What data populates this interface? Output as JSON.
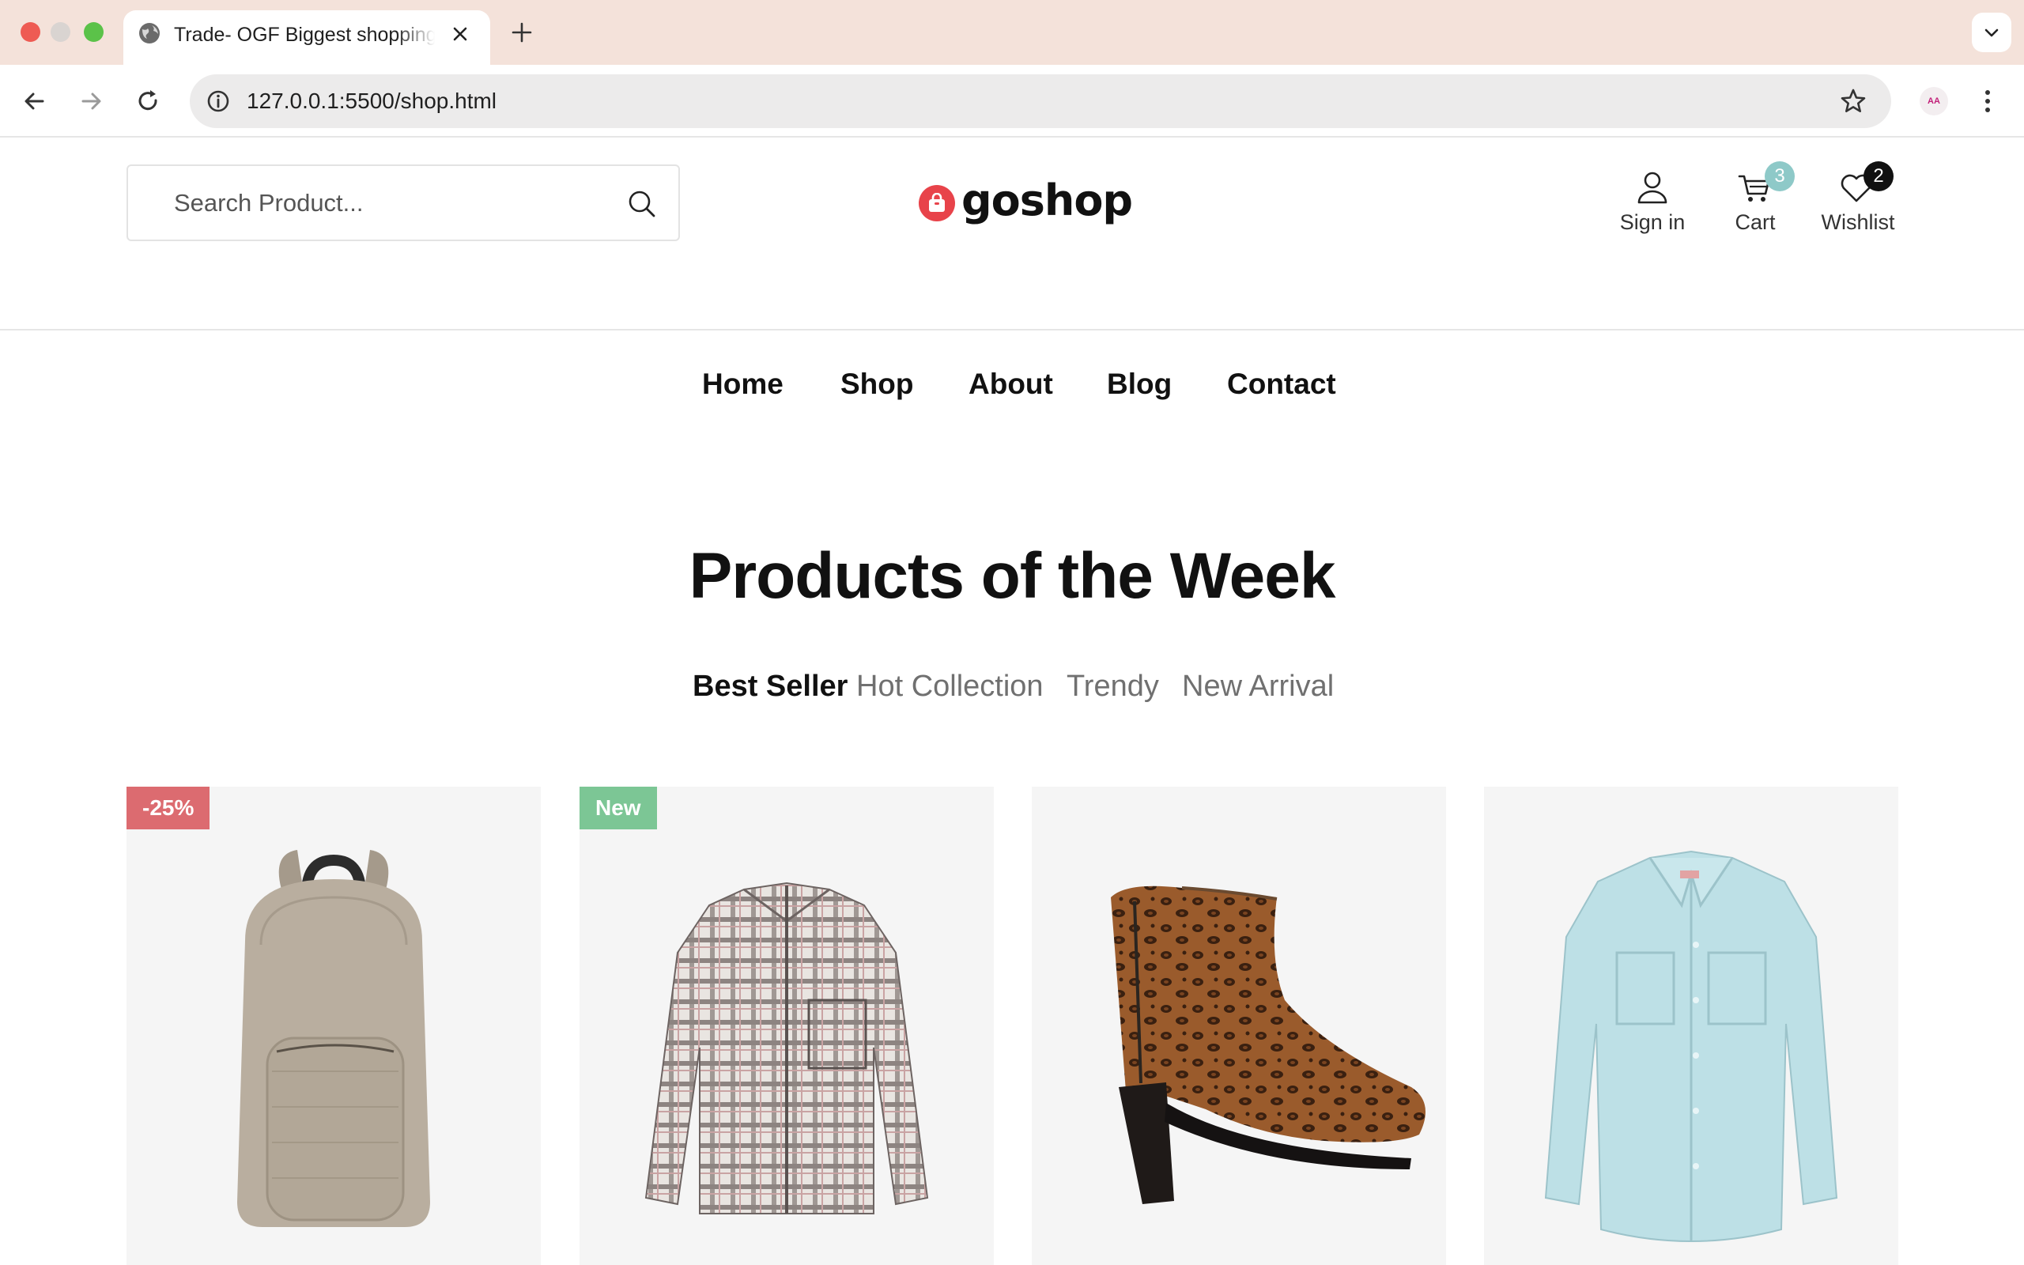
{
  "browser": {
    "tab_title": "Trade- OGF Biggest shopping center",
    "url": "127.0.0.1:5500/shop.html",
    "extension_label": "AA"
  },
  "header": {
    "search_placeholder": "Search Product...",
    "logo_text": "goshop",
    "actions": {
      "sign_in": "Sign in",
      "cart": "Cart",
      "cart_count": "3",
      "wishlist": "Wishlist",
      "wishlist_count": "2"
    },
    "colors": {
      "brand": "#e8434a",
      "cart_badge": "#8ec9c8",
      "wishlist_badge": "#111111"
    }
  },
  "nav": {
    "items": [
      {
        "label": "Home"
      },
      {
        "label": "Shop"
      },
      {
        "label": "About"
      },
      {
        "label": "Blog"
      },
      {
        "label": "Contact"
      }
    ]
  },
  "section": {
    "title": "Products of the Week",
    "tabs": [
      {
        "label": "Best Seller",
        "active": true
      },
      {
        "label": "Hot Collection",
        "active": false
      },
      {
        "label": "Trendy",
        "active": false
      },
      {
        "label": "New Arrival",
        "active": false
      }
    ]
  },
  "products": [
    {
      "badge": "-25%",
      "badge_color": "#dc6b70",
      "image": "beige-backpack"
    },
    {
      "badge": "New",
      "badge_color": "#7cc695",
      "image": "plaid-flannel-shirt"
    },
    {
      "badge": "",
      "image": "leopard-ankle-boot"
    },
    {
      "badge": "",
      "image": "light-blue-button-shirt"
    }
  ]
}
